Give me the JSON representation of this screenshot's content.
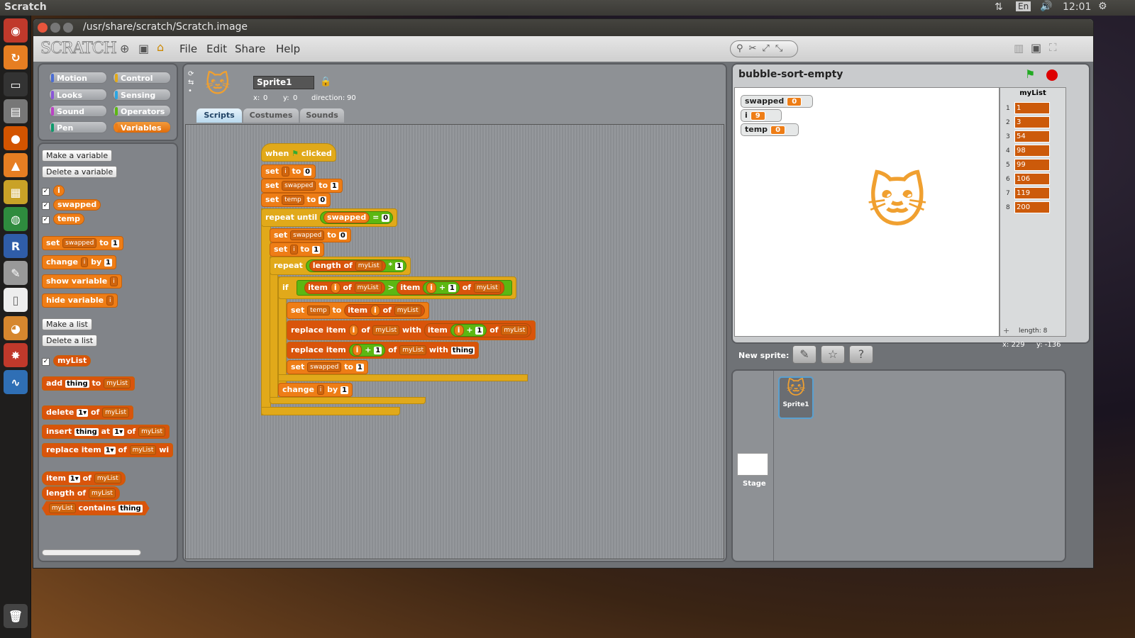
{
  "topbar": {
    "app_name": "Scratch",
    "keyboard": "En",
    "clock": "12:01"
  },
  "window": {
    "title": "/usr/share/scratch/Scratch.image"
  },
  "menu": {
    "logo": "SCRATCH",
    "file": "File",
    "edit": "Edit",
    "share": "Share",
    "help": "Help"
  },
  "categories": {
    "motion": "Motion",
    "control": "Control",
    "looks": "Looks",
    "sensing": "Sensing",
    "sound": "Sound",
    "operators": "Operators",
    "pen": "Pen",
    "variables": "Variables"
  },
  "palette": {
    "make_variable": "Make a variable",
    "delete_variable": "Delete a variable",
    "var_i": "i",
    "var_swapped": "swapped",
    "var_temp": "temp",
    "set": "set",
    "to": "to",
    "swapped": "swapped",
    "one": "1",
    "change": "change",
    "i": "i",
    "by": "by",
    "show_variable": "show variable",
    "hide_variable": "hide variable",
    "make_list": "Make a list",
    "delete_list": "Delete a list",
    "list_mylist": "myList",
    "add": "add",
    "thing": "thing",
    "mylist": "myList",
    "delete": "delete",
    "of": "of",
    "one_dd": "1▾",
    "insert": "insert",
    "at": "at",
    "replace_item": "replace item",
    "wi": "wi",
    "item": "item",
    "length_of": "length of",
    "contains": "contains"
  },
  "sprite": {
    "name": "Sprite1",
    "x_label": "x:",
    "x": "0",
    "y_label": "y:",
    "y": "0",
    "dir_label": "direction:",
    "dir": "90"
  },
  "tabs": {
    "scripts": "Scripts",
    "costumes": "Costumes",
    "sounds": "Sounds"
  },
  "script": {
    "when": "when",
    "clicked": "clicked",
    "set": "set",
    "to": "to",
    "i": "i",
    "zero": "0",
    "one": "1",
    "swapped": "swapped",
    "temp": "temp",
    "repeat_until": "repeat until",
    "eq": "=",
    "repeat": "repeat",
    "length_of": "length of",
    "mylist": "myList",
    "times": "*",
    "if": "if",
    "item": "item",
    "of": "of",
    "gt": ">",
    "plus": "+",
    "replace_item": "replace item",
    "with": "with",
    "thing": "thing",
    "change": "change",
    "by": "by"
  },
  "stage": {
    "project_name": "bubble-sort-empty",
    "monitors": [
      {
        "name": "swapped",
        "value": "0"
      },
      {
        "name": "i",
        "value": "9"
      },
      {
        "name": "temp",
        "value": "0"
      }
    ],
    "list": {
      "title": "myList",
      "items": [
        "1",
        "3",
        "54",
        "98",
        "99",
        "106",
        "119",
        "200"
      ],
      "length_label": "length: 8"
    },
    "mouse_x": "x: 229",
    "mouse_y": "y: -136"
  },
  "sprites_pane": {
    "new_sprite": "New sprite:",
    "stage_label": "Stage",
    "sprite_name": "Sprite1"
  }
}
